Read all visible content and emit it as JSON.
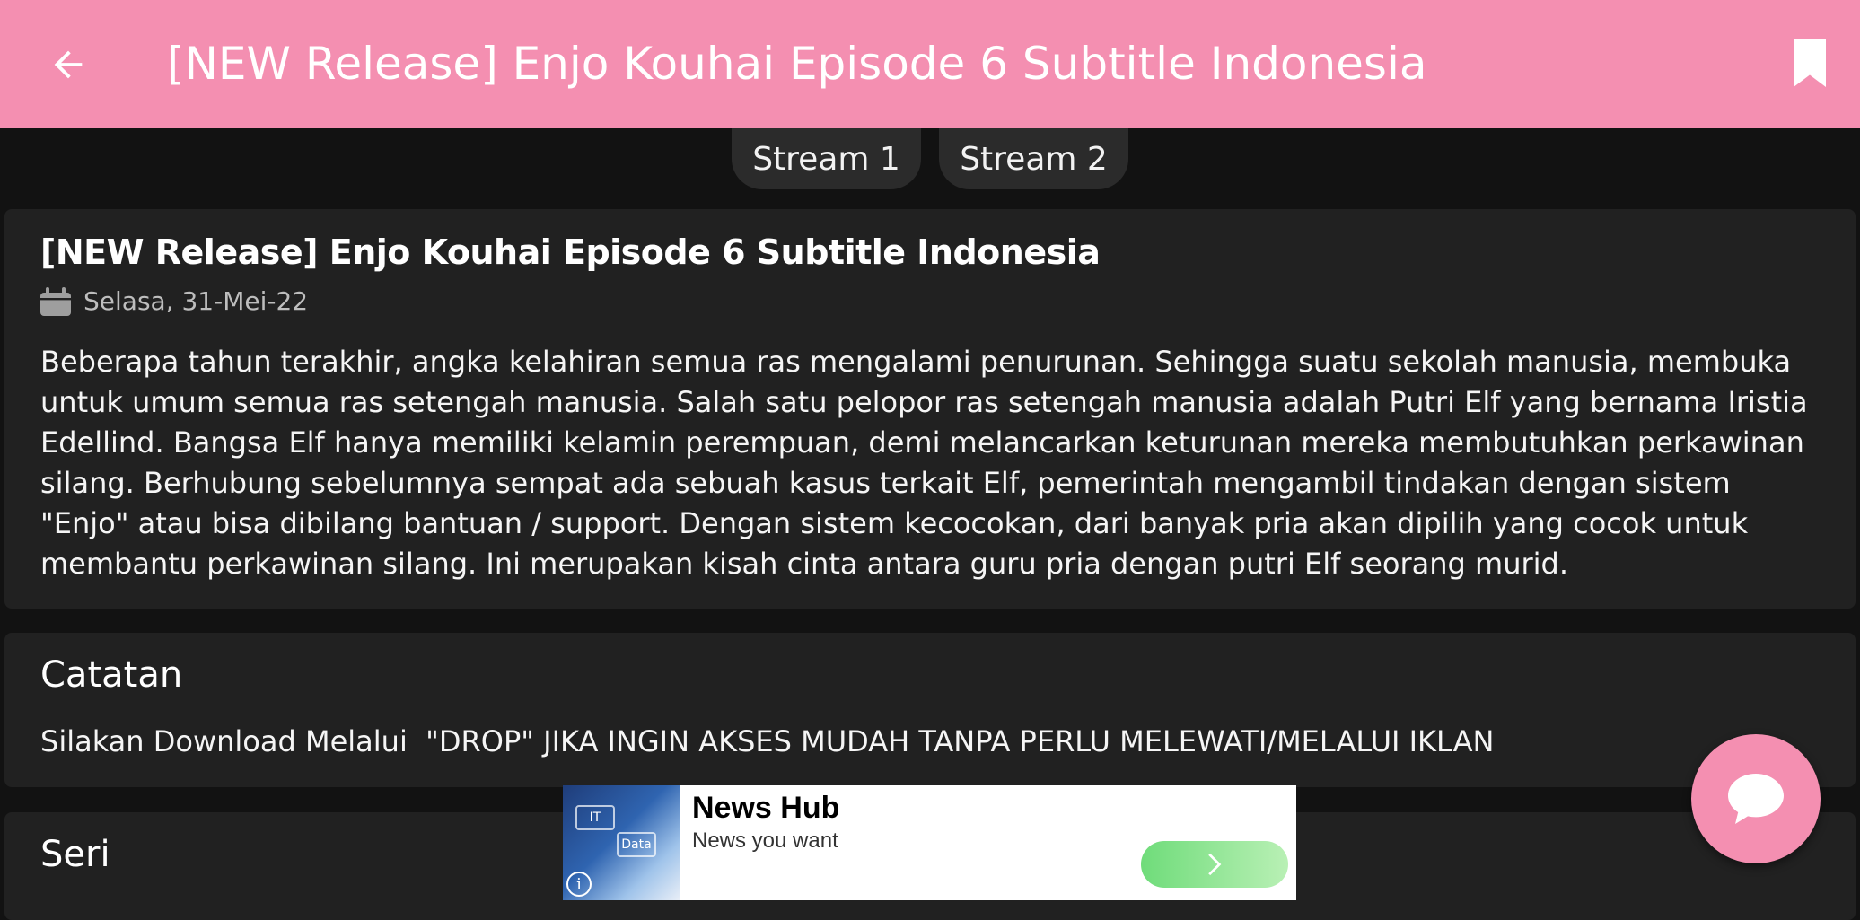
{
  "app_bar": {
    "title": "[NEW Release] Enjo Kouhai Episode 6 Subtitle Indonesia",
    "back_icon": "arrow-left-icon",
    "bookmark_icon": "bookmark-icon",
    "color": "#f48fb1"
  },
  "streams": [
    {
      "label": "Stream 1"
    },
    {
      "label": "Stream 2"
    }
  ],
  "post": {
    "title": "[NEW Release] Enjo Kouhai Episode 6 Subtitle Indonesia",
    "date_icon": "calendar-icon",
    "date": "Selasa, 31-Mei-22",
    "synopsis": "Beberapa tahun terakhir, angka kelahiran semua ras mengalami penurunan. Sehingga suatu sekolah manusia, membuka untuk umum semua ras setengah manusia. Salah satu pelopor ras setengah manusia adalah Putri Elf yang bernama Iristia Edellind. Bangsa Elf hanya memiliki kelamin perempuan, demi melancarkan keturunan mereka membutuhkan perkawinan silang. Berhubung sebelumnya sempat ada sebuah kasus terkait Elf, pemerintah mengambil tindakan dengan sistem \"Enjo\" atau bisa dibilang bantuan / support. Dengan sistem kecocokan, dari banyak pria akan dipilih yang cocok untuk membantu perkawinan silang. Ini merupakan kisah cinta antara guru pria dengan putri Elf seorang murid."
  },
  "notes": {
    "heading": "Catatan",
    "text": "Silakan Download Melalui  \"DROP\" JIKA INGIN AKSES MUDAH TANPA PERLU MELEWATI/MELALUI IKLAN"
  },
  "series": {
    "heading": "Seri"
  },
  "ad": {
    "name": "News Hub",
    "tagline": "News you want",
    "info_icon": "info-icon",
    "cta_icon": "chevron-right-icon",
    "thumb_labels": [
      "IT",
      "Data"
    ]
  },
  "fab": {
    "icon": "chat-bubble-icon"
  }
}
